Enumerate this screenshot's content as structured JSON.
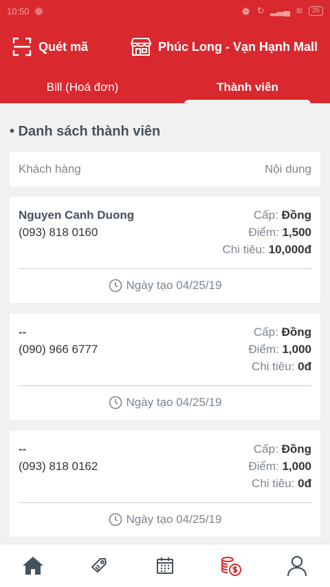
{
  "status_bar": {
    "time": "10:50",
    "battery": "26"
  },
  "header": {
    "scan_label": "Quét mã",
    "store_name": "Phúc Long - Vạn Hạnh Mall"
  },
  "tabs": [
    {
      "label": "Bill (Hoá đơn)",
      "active": false
    },
    {
      "label": "Thành viên",
      "active": true
    }
  ],
  "section_title": "• Danh sách thành viên",
  "columns": {
    "left": "Khách hàng",
    "right": "Nội dung"
  },
  "members": [
    {
      "name": "Nguyen Canh Duong",
      "phone": "(093) 818 0160",
      "tier_label": "Cấp:",
      "tier": "Đồng",
      "points_label": "Điểm:",
      "points": "1,500",
      "spend_label": "Chi tiêu:",
      "spend": "10,000đ",
      "date_label": "Ngày tạo 04/25/19"
    },
    {
      "name": "--",
      "phone": "(090) 966 6777",
      "tier_label": "Cấp:",
      "tier": "Đồng",
      "points_label": "Điểm:",
      "points": "1,000",
      "spend_label": "Chi tiêu:",
      "spend": "0đ",
      "date_label": "Ngày tạo 04/25/19"
    },
    {
      "name": "--",
      "phone": "(093) 818 0162",
      "tier_label": "Cấp:",
      "tier": "Đồng",
      "points_label": "Điểm:",
      "points": "1,000",
      "spend_label": "Chi tiêu:",
      "spend": "0đ",
      "date_label": "Ngày tạo 04/25/19"
    }
  ],
  "bottom_nav": [
    {
      "icon": "home-icon",
      "active": false
    },
    {
      "icon": "coupon-icon",
      "active": false
    },
    {
      "icon": "calendar-icon",
      "active": false
    },
    {
      "icon": "coins-icon",
      "active": true
    },
    {
      "icon": "user-icon",
      "active": false
    }
  ],
  "colors": {
    "brand_red": "#d9292e",
    "text_dark": "#44525e",
    "text_muted": "#7d858c",
    "nav_icon": "#44525e"
  }
}
